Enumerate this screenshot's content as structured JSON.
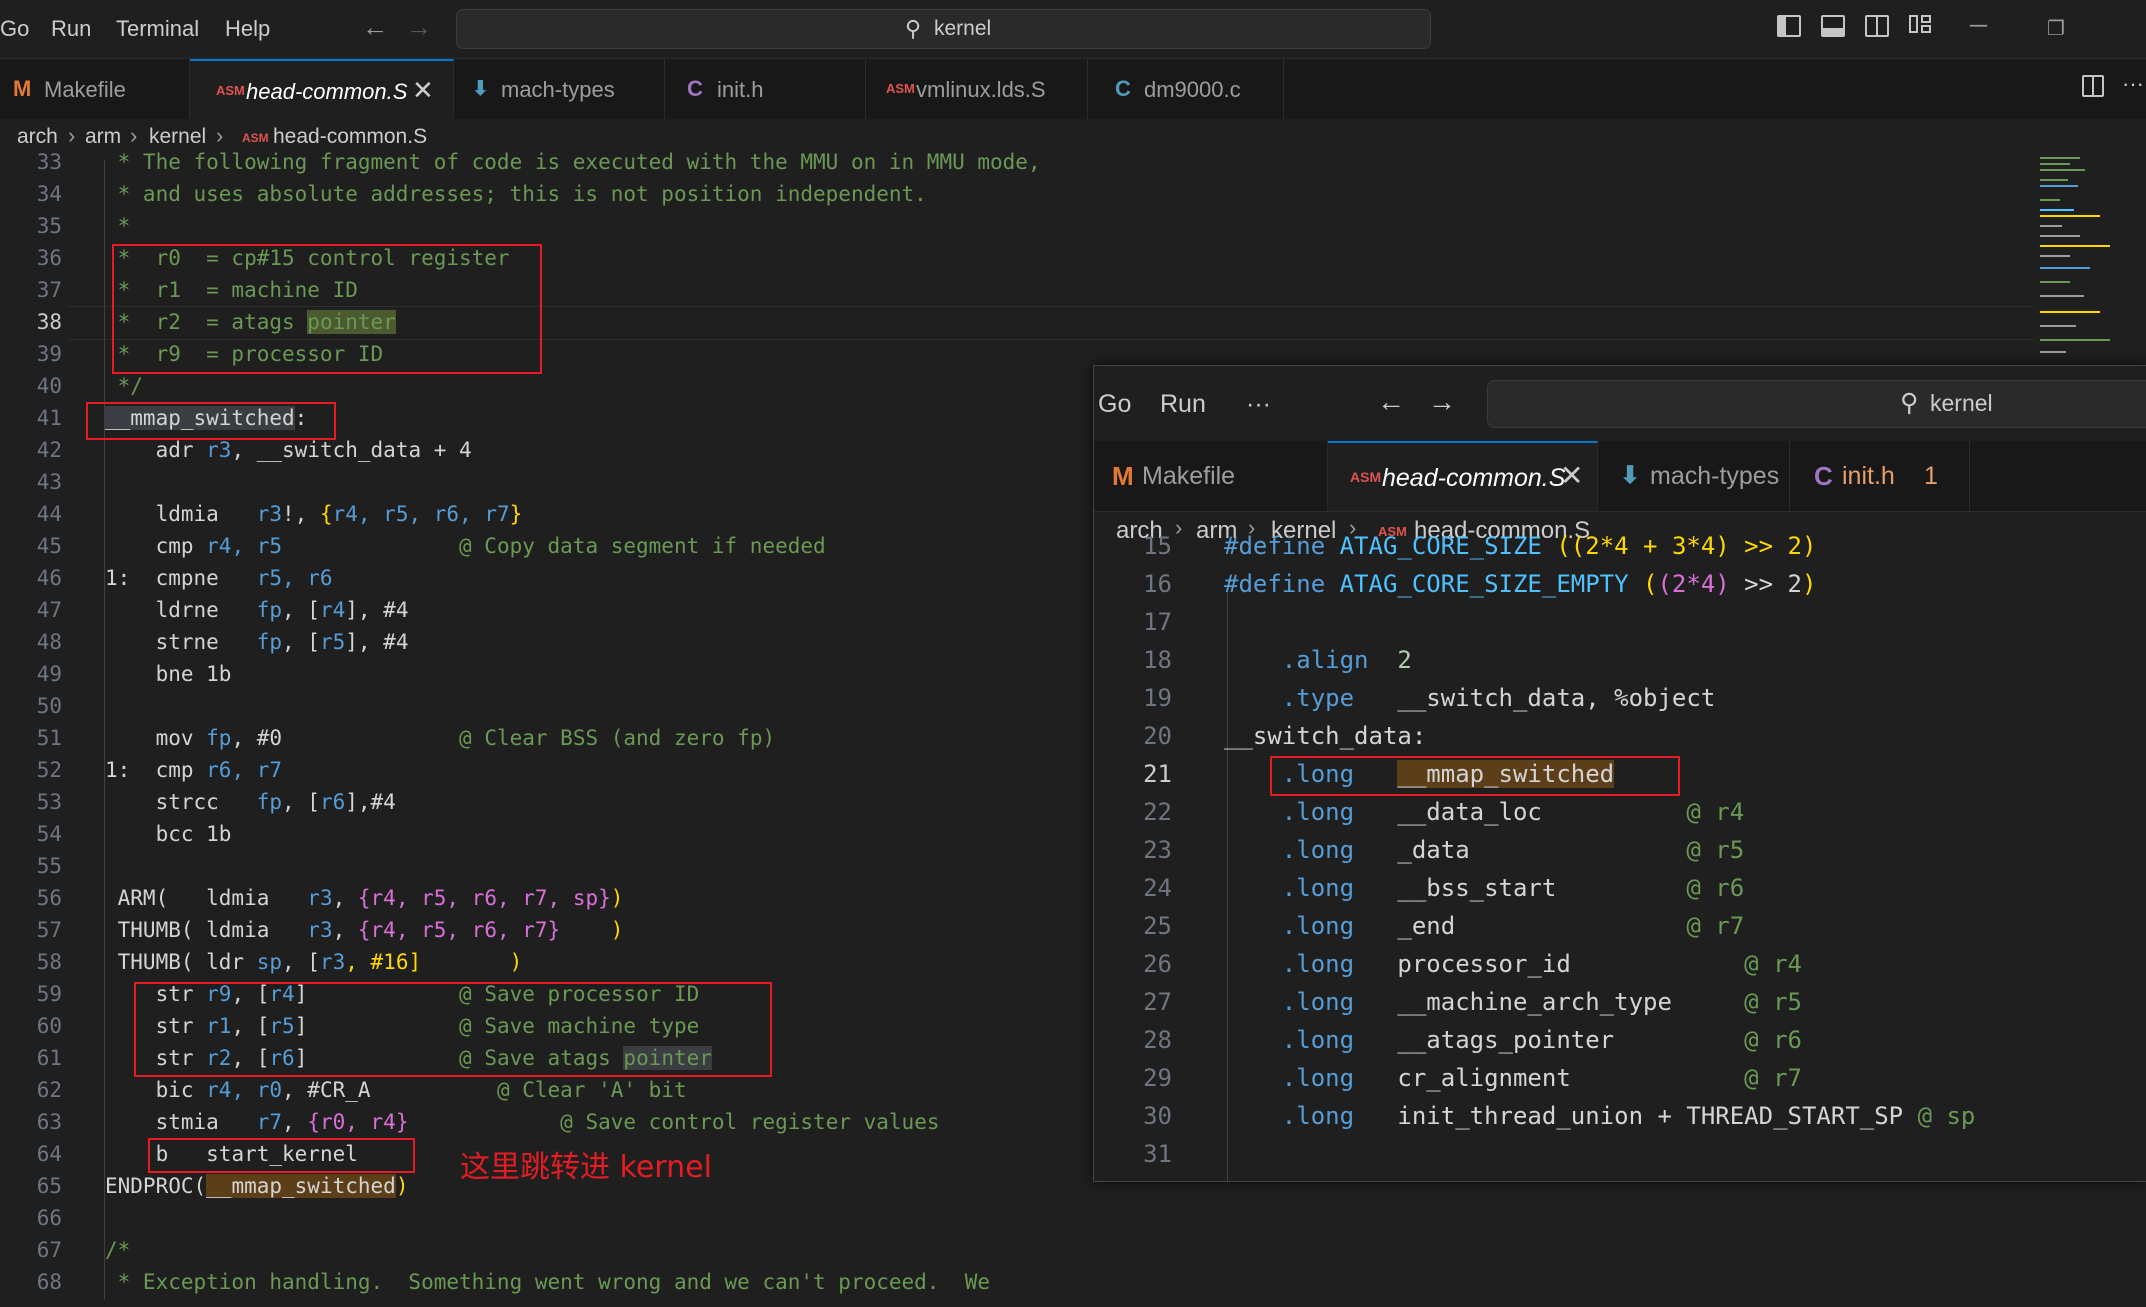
{
  "menu": {
    "go": "Go",
    "run": "Run",
    "terminal": "Terminal",
    "help": "Help"
  },
  "search": {
    "text": "kernel"
  },
  "tabs": [
    {
      "icon": "M",
      "label": "Makefile"
    },
    {
      "icon": "ASM",
      "label": "head-common.S",
      "close": "✕"
    },
    {
      "icon": "⬇",
      "label": "mach-types"
    },
    {
      "icon": "C",
      "label": "init.h"
    },
    {
      "icon": "ASM",
      "label": "vmlinux.lds.S"
    },
    {
      "icon": "C",
      "label": "dm9000.c"
    }
  ],
  "breadcrumb": {
    "a": "arch",
    "b": "arm",
    "c": "kernel",
    "icon": "ASM",
    "d": "head-common.S"
  },
  "lines": {
    "n33": "33",
    "n34": "34",
    "n35": "35",
    "n36": "36",
    "n37": "37",
    "n38": "38",
    "n39": "39",
    "n40": "40",
    "n41": "41",
    "n42": "42",
    "n43": "43",
    "n44": "44",
    "n45": "45",
    "n46": "46",
    "n47": "47",
    "n48": "48",
    "n49": "49",
    "n50": "50",
    "n51": "51",
    "n52": "52",
    "n53": "53",
    "n54": "54",
    "n55": "55",
    "n56": "56",
    "n57": "57",
    "n58": "58",
    "n59": "59",
    "n60": "60",
    "n61": "61",
    "n62": "62",
    "n63": "63",
    "n64": "64",
    "n65": "65",
    "n66": "66",
    "n67": "67",
    "n68": "68"
  },
  "code": {
    "l33": " * The following fragment of code is executed with the MMU on in MMU mode,",
    "l34": " * and uses absolute addresses; this is not position independent.",
    "l35": " *",
    "l36": " *  r0  = cp#15 control register",
    "l37": " *  r1  = machine ID",
    "l38a": " *  r2  = atags ",
    "l38b": "pointer",
    "l39": " *  r9  = processor ID",
    "l40": " */",
    "l41a": "__mmap_switched",
    "l41b": ":",
    "l42a": "    adr ",
    "l42b": "r3",
    "l42c": ", ",
    "l42d": "__switch_data",
    "l42e": " + 4",
    "l44a": "    ldmia   ",
    "l44b": "r3",
    "l44c": "!, ",
    "l44d": "{",
    "l44e": "r4, r5, r6, r7",
    "l44f": "}",
    "l45a": "    cmp ",
    "l45b": "r4, r5",
    "l45c": "              @ Copy data segment if needed",
    "l46a": "1:  cmpne   ",
    "l46b": "r5, r6",
    "l47a": "    ldrne   ",
    "l47b": "fp",
    "l47c": ", [",
    "l47d": "r4",
    "l47e": "], #4",
    "l48a": "    strne   ",
    "l48b": "fp",
    "l48c": ", [",
    "l48d": "r5",
    "l48e": "], #4",
    "l49": "    bne 1b",
    "l51a": "    mov ",
    "l51b": "fp",
    "l51c": ", #0",
    "l51d": "              @ Clear BSS (and zero fp)",
    "l52a": "1:  cmp ",
    "l52b": "r6, r7",
    "l53a": "    strcc   ",
    "l53b": "fp",
    "l53c": ", [",
    "l53d": "r6",
    "l53e": "],#4",
    "l54": "    bcc 1b",
    "l56a": " ARM(   ldmia   ",
    "l56b": "r3",
    "l56c": ", ",
    "l56d": "{r4, r5, r6, r7, sp}",
    "l56e": ")",
    "l57a": " THUMB( ldmia   ",
    "l57b": "r3",
    "l57c": ", ",
    "l57d": "{r4, r5, r6, r7}",
    "l57e": "    )",
    "l58a": " THUMB( ldr ",
    "l58b": "sp",
    "l58c": ", [",
    "l58d": "r3",
    "l58e": ", #16]       )",
    "l59a": "    str ",
    "l59b": "r9",
    "l59c": ", [",
    "l59d": "r4",
    "l59e": "]",
    "l59f": "            @ Save processor ID",
    "l60a": "    str ",
    "l60b": "r1",
    "l60c": ", [",
    "l60d": "r5",
    "l60e": "]",
    "l60f": "            @ Save machine type",
    "l61a": "    str ",
    "l61b": "r2",
    "l61c": ", [",
    "l61d": "r6",
    "l61e": "]",
    "l61f": "            @ Save atags ",
    "l61g": "pointer",
    "l62a": "    bic ",
    "l62b": "r4, r0",
    "l62c": ", #CR_A",
    "l62d": "          @ Clear 'A' bit",
    "l63a": "    stmia   ",
    "l63b": "r7",
    "l63c": ", ",
    "l63d": "{r0, r4}",
    "l63e": "            @ Save control register values",
    "l64a": "    b   ",
    "l64b": "start_kernel",
    "l65a": "ENDPROC(",
    "l65b": "__mmap_switched",
    "l65c": ")",
    "l67": "/*",
    "l68": " * Exception handling.  Something went wrong and we can't proceed.  We"
  },
  "annotation": "这里跳转进 kernel",
  "overlay": {
    "menu": {
      "go": "Go",
      "run": "Run",
      "more": "···"
    },
    "search": "kernel",
    "tabs": [
      {
        "icon": "M",
        "label": "Makefile"
      },
      {
        "icon": "ASM",
        "label": "head-common.S",
        "close": "✕"
      },
      {
        "icon": "⬇",
        "label": "mach-types"
      },
      {
        "icon": "C",
        "label": "init.h",
        "badge": "1"
      }
    ],
    "breadcrumb": {
      "a": "arch",
      "b": "arm",
      "c": "kernel",
      "icon": "ASM",
      "d": "head-common.S"
    },
    "lines": {
      "n15": "15",
      "n16": "16",
      "n17": "17",
      "n18": "18",
      "n19": "19",
      "n20": "20",
      "n21": "21",
      "n22": "22",
      "n23": "23",
      "n24": "24",
      "n25": "25",
      "n26": "26",
      "n27": "27",
      "n28": "28",
      "n29": "29",
      "n30": "30",
      "n31": "31"
    },
    "code": {
      "l15a": "#define ",
      "l15b": "ATAG_CORE_SIZE ",
      "l15c": "((2*4 + 3*4) >> 2)",
      "l16a": "#define ",
      "l16b": "ATAG_CORE_SIZE_EMPTY ",
      "l16c": "(",
      "l16d": "(2*4)",
      "l16e": " >> 2",
      "l16f": ")",
      "l18a": "    .align  ",
      "l18b": "2",
      "l19a": "    .type   ",
      "l19b": "__switch_data, %object",
      "l20": "__switch_data:",
      "l21a": "    .long   ",
      "l21b": "__mmap_switched",
      "l22a": "    .long   ",
      "l22b": "__data_loc",
      "l22c": "          @ r4",
      "l23a": "    .long   ",
      "l23b": "_data",
      "l23c": "               @ r5",
      "l24a": "    .long   ",
      "l24b": "__bss_start",
      "l24c": "         @ r6",
      "l25a": "    .long   ",
      "l25b": "_end",
      "l25c": "                @ r7",
      "l26a": "    .long   ",
      "l26b": "processor_id",
      "l26c": "            @ r4",
      "l27a": "    .long   ",
      "l27b": "__machine_arch_type",
      "l27c": "     @ r5",
      "l28a": "    .long   ",
      "l28b": "__atags_pointer",
      "l28c": "         @ r6",
      "l29a": "    .long   ",
      "l29b": "cr_alignment",
      "l29c": "            @ r7",
      "l30a": "    .long   ",
      "l30b": "init_thread_union + THREAD_START_SP",
      "l30c": " @ sp"
    }
  }
}
